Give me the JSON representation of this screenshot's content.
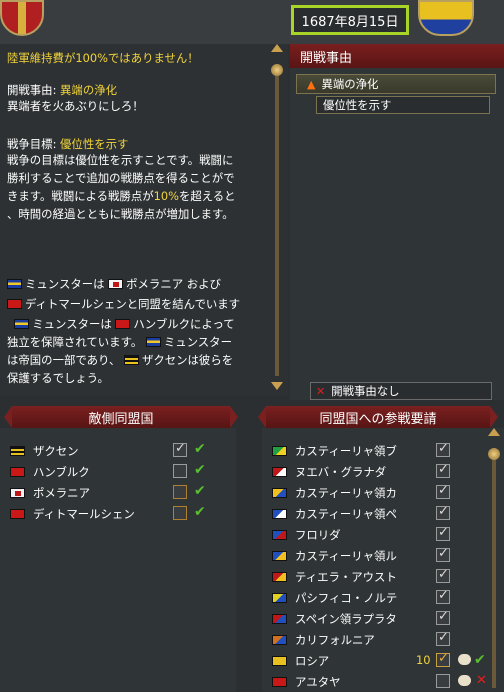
{
  "top_bar": {
    "date": "1687年8月15日",
    "date_highlight_color": "#a8d428"
  },
  "description": {
    "warning": "陸軍維持費が100%ではありません！",
    "cb_label": "開戦事由:",
    "cb_value": "異端の浄化",
    "cb_flavor": "異端者を火あぶりにしろ！",
    "goal_label": "戦争目標:",
    "goal_value": "優位性を示す",
    "goal_desc": [
      "戦争の目標は優位性を示すことです。戦闘に",
      "勝利することで追加の戦勝点を得ることがで",
      "きます。戦闘による戦勝点が",
      "を超えると",
      "、時間の経過とともに戦勝点が増加します。"
    ],
    "goal_percent": "10%",
    "alliance_text": {
      "a1": "ミュンスターは",
      "a2": "ポメラニア および",
      "a3": "ディトマールシェンと同盟を結んでいます",
      "a4": "ミュンスターは",
      "a5": "ハンブルクによって",
      "a6": "独立を保障されています。",
      "a7": "ミュンスター",
      "a8": "は帝国の一部であり、",
      "a9": "ザクセンは彼らを",
      "a10": "保護するでしょう。"
    }
  },
  "casus_belli_panel": {
    "title": "開戦事由",
    "selected": "異端の浄化",
    "goal": "優位性を示す",
    "none_option": "開戦事由なし"
  },
  "enemy_allies": {
    "title": "敵側同盟国",
    "rows": [
      {
        "name": "ザクセン",
        "checked": true,
        "flag": "saxony"
      },
      {
        "name": "ハンブルク",
        "checked": false,
        "flag": "hamburg"
      },
      {
        "name": "ポメラニア",
        "checked": false,
        "flag": "pomerania"
      },
      {
        "name": "ディトマールシェン",
        "checked": false,
        "flag": "dithmarschen"
      }
    ]
  },
  "ally_requests": {
    "title": "同盟国への参戦要請",
    "rows": [
      {
        "name": "カスティーリャ領ブ",
        "checked": true
      },
      {
        "name": "ヌエバ・グラナダ",
        "checked": true
      },
      {
        "name": "カスティーリャ領カ",
        "checked": true
      },
      {
        "name": "カスティーリャ領ペ",
        "checked": true
      },
      {
        "name": "フロリダ",
        "checked": true
      },
      {
        "name": "カスティーリャ領ル",
        "checked": true
      },
      {
        "name": "ティエラ・アウスト",
        "checked": true
      },
      {
        "name": "パシフィコ・ノルテ",
        "checked": true
      },
      {
        "name": "スペイン領ラプラタ",
        "checked": true
      },
      {
        "name": "カリフォルニア",
        "checked": true
      },
      {
        "name": "ロシア",
        "checked": true,
        "score": "10"
      },
      {
        "name": "アユタヤ",
        "checked": false
      }
    ]
  },
  "colors": {
    "yellow_text": "#f2d43a",
    "header_red": "#7a2020",
    "panel_bg": "#2f3436",
    "green_check": "#58c030",
    "red_x": "#e02020"
  },
  "icons": {
    "flame": "flame-icon",
    "checkmark": "check-icon",
    "cross": "cross-icon",
    "message": "message-icon"
  }
}
